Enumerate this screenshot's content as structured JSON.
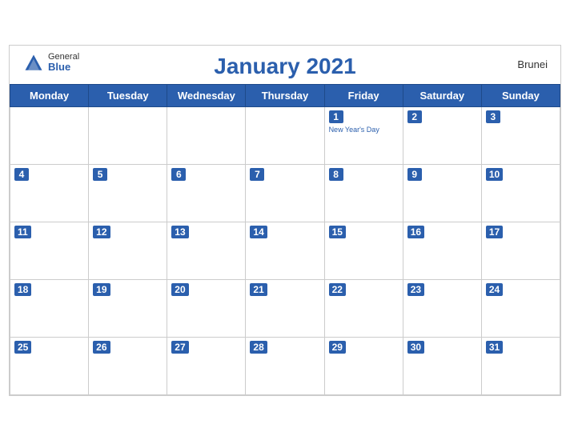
{
  "header": {
    "title": "January 2021",
    "country": "Brunei",
    "logo": {
      "general": "General",
      "blue": "Blue"
    }
  },
  "weekdays": [
    "Monday",
    "Tuesday",
    "Wednesday",
    "Thursday",
    "Friday",
    "Saturday",
    "Sunday"
  ],
  "weeks": [
    [
      {
        "day": null
      },
      {
        "day": null
      },
      {
        "day": null
      },
      {
        "day": null
      },
      {
        "day": 1,
        "holiday": "New Year's Day"
      },
      {
        "day": 2
      },
      {
        "day": 3
      }
    ],
    [
      {
        "day": 4
      },
      {
        "day": 5
      },
      {
        "day": 6
      },
      {
        "day": 7
      },
      {
        "day": 8
      },
      {
        "day": 9
      },
      {
        "day": 10
      }
    ],
    [
      {
        "day": 11
      },
      {
        "day": 12
      },
      {
        "day": 13
      },
      {
        "day": 14
      },
      {
        "day": 15
      },
      {
        "day": 16
      },
      {
        "day": 17
      }
    ],
    [
      {
        "day": 18
      },
      {
        "day": 19
      },
      {
        "day": 20
      },
      {
        "day": 21
      },
      {
        "day": 22
      },
      {
        "day": 23
      },
      {
        "day": 24
      }
    ],
    [
      {
        "day": 25
      },
      {
        "day": 26
      },
      {
        "day": 27
      },
      {
        "day": 28
      },
      {
        "day": 29
      },
      {
        "day": 30
      },
      {
        "day": 31
      }
    ]
  ]
}
